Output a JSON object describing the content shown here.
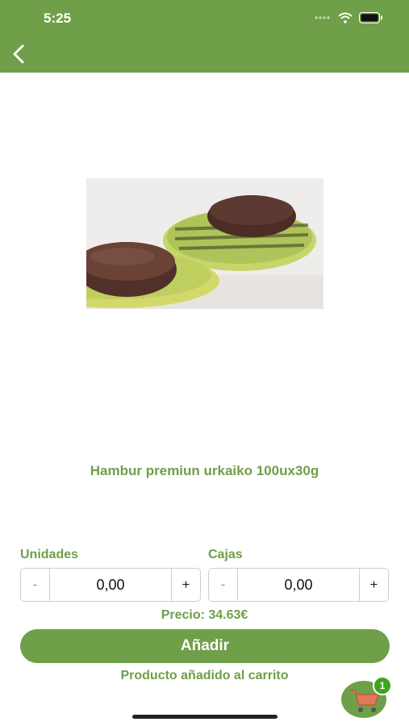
{
  "status_bar": {
    "time": "5:25"
  },
  "header": {
    "back_icon": "chevron-left-icon",
    "color": "#6f9f48"
  },
  "product": {
    "name": "Hambur premiun urkaiko 100ux30g"
  },
  "quantity": {
    "units": {
      "label": "Unidades",
      "minus": "-",
      "value": "0,00",
      "plus": "+"
    },
    "boxes": {
      "label": "Cajas",
      "minus": "-",
      "value": "0,00",
      "plus": "+"
    }
  },
  "price": {
    "text": "Precio: 34.63€"
  },
  "add_button": {
    "label": "Añadir"
  },
  "added_message": "Producto añadido al carrito",
  "cart": {
    "icon": "shopping-cart-icon",
    "badge": "1"
  }
}
